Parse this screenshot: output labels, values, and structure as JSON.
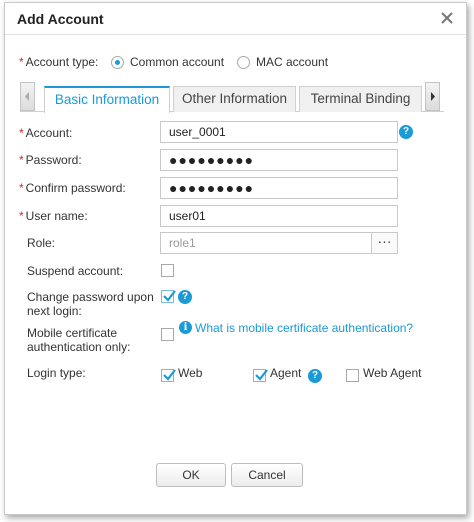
{
  "dialog": {
    "title": "Add Account",
    "close_icon": "close-x-icon"
  },
  "account_type": {
    "label": "Account type:",
    "options": [
      {
        "label": "Common account",
        "selected": true
      },
      {
        "label": "MAC account",
        "selected": false
      }
    ]
  },
  "tabs": [
    {
      "label": "Basic Information",
      "active": true
    },
    {
      "label": "Other Information",
      "active": false
    },
    {
      "label": "Terminal Binding",
      "active": false
    }
  ],
  "form": {
    "account": {
      "label": "Account:",
      "value": "user_0001",
      "required": true
    },
    "password": {
      "label": "Password:",
      "value": "●●●●●●●●●",
      "required": true
    },
    "confirm_password": {
      "label": "Confirm password:",
      "value": "●●●●●●●●●",
      "required": true
    },
    "user_name": {
      "label": "User name:",
      "value": "user01",
      "required": true
    },
    "role": {
      "label": "Role:",
      "value": "role1",
      "browse": "···"
    },
    "suspend": {
      "label": "Suspend account:",
      "checked": false
    },
    "change_password": {
      "label_line1": "Change password upon",
      "label_line2": "next login:",
      "checked": true
    },
    "mobile_cert": {
      "label_line1": "Mobile certificate",
      "label_line2": "authentication only:",
      "checked": false,
      "link": "What is mobile certificate authentication?"
    },
    "login_type": {
      "label": "Login type:",
      "options": [
        {
          "label": "Web",
          "checked": true
        },
        {
          "label": "Agent",
          "checked": true
        },
        {
          "label": "Web Agent",
          "checked": false
        }
      ]
    }
  },
  "buttons": {
    "ok": "OK",
    "cancel": "Cancel"
  },
  "colors": {
    "accent": "#1a9ad6",
    "required": "#e02020"
  },
  "icons": {
    "help": "?",
    "info": "i"
  }
}
